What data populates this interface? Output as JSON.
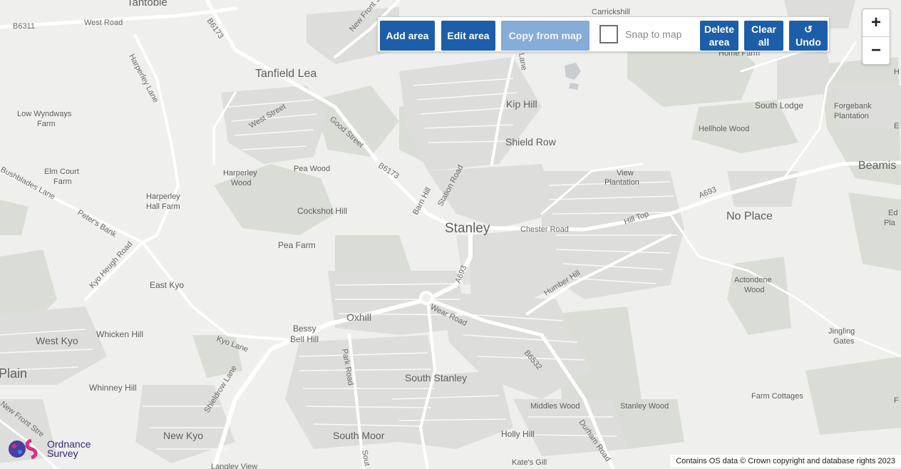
{
  "toolbar": {
    "add_area": "Add area",
    "edit_area": "Edit area",
    "copy_from_map": "Copy from map",
    "snap_to_map": "Snap to map",
    "delete_area_line1": "Delete",
    "delete_area_line2": "area",
    "clear_all_line1": "Clear",
    "clear_all_line2": "all",
    "undo_icon": "↺",
    "undo": "Undo"
  },
  "zoom": {
    "in": "+",
    "out": "−"
  },
  "attribution": "Contains OS data © Crown copyright and database rights 2023",
  "logo": {
    "line1": "Ordnance",
    "line2": "Survey"
  },
  "colors": {
    "button": "#1d5ea8",
    "button_disabled": "#86acd8",
    "map_bg": "#efefed",
    "road": "#ffffff",
    "building": "#dcdcda",
    "green": "#d8ddd5"
  },
  "places": {
    "tantobie": "Tantobie",
    "carrickshill": "Carrickshill",
    "tanfield_lea": "Tanfield Lea",
    "kip_hill": "Kip Hill",
    "shield_row": "Shield Row",
    "low_wyndways_1": "Low Wyndways",
    "low_wyndways_2": "Farm",
    "elm_court_1": "Elm Court",
    "elm_court_2": "Farm",
    "harperley_wood_1": "Harperley",
    "harperley_wood_2": "Wood",
    "pea_wood": "Pea Wood",
    "harperley_hall_1": "Harperley",
    "harperley_hall_2": "Hall Farm",
    "cockshot_hill": "Cockshot Hill",
    "stanley": "Stanley",
    "view_plantation_1": "View",
    "view_plantation_2": "Plantation",
    "no_place": "No Place",
    "beamish": "Beamis",
    "south_lodge": "South Lodge",
    "forgebank_1": "Forgebank",
    "forgebank_2": "Plantation",
    "hellhole_wood": "Hellhole Wood",
    "home_farm": "Home Farm",
    "pea_farm": "Pea Farm",
    "east_kyo": "East Kyo",
    "oxhill": "Oxhill",
    "bessy_1": "Bessy",
    "bessy_2": "Bell Hill",
    "west_kyo": "West Kyo",
    "whicken_hill": "Whicken Hill",
    "plain": "Plain",
    "whinney_hill": "Whinney Hill",
    "south_stanley": "South Stanley",
    "new_kyo": "New Kyo",
    "south_moor": "South Moor",
    "holly_hill": "Holly Hill",
    "middles_wood": "Middles Wood",
    "stanley_wood": "Stanley Wood",
    "farm_cottages": "Farm Cottages",
    "actondene_1": "Actondene",
    "actondene_2": "Wood",
    "jingling_1": "Jingling",
    "jingling_2": "Gates",
    "kates_gill": "Kate's Gill",
    "langley_view": "Langley View",
    "edge_ed": "Ed",
    "edge_pla": "Pla",
    "edge_e": "E",
    "edge_f": "F",
    "edge_h": "H"
  },
  "roads": {
    "b6311": "B6311",
    "west_road": "West Road",
    "b6173_top": "B6173",
    "new_front_street": "New Front St",
    "harperley_lane": "Harperley Lane",
    "west_street": "West Street",
    "good_street": "Good Street",
    "b6173_mid": "B6173",
    "barn_hill": "Barn Hill",
    "station_road": "Station Road",
    "bushblades_lane": "Bushblades Lane",
    "peters_bank": "Peter's Bank",
    "kyo_heugh_road": "Kyo Heugh Road",
    "chester_road": "Chester Road",
    "hill_top": "Hill Top",
    "a693_east": "A693",
    "a693_mid": "A693",
    "humber_hill": "Humber Hill",
    "wear_road": "Wear Road",
    "b6532": "B6532",
    "kyo_lane": "Kyo Lane",
    "park_road": "Park Road",
    "shieldrow_lane": "Shieldrow Lane",
    "new_front_street_sw": "New Front Stre",
    "durham_road": "Durham Road",
    "south_rd": "Sout",
    "lane_top": "Lane"
  }
}
